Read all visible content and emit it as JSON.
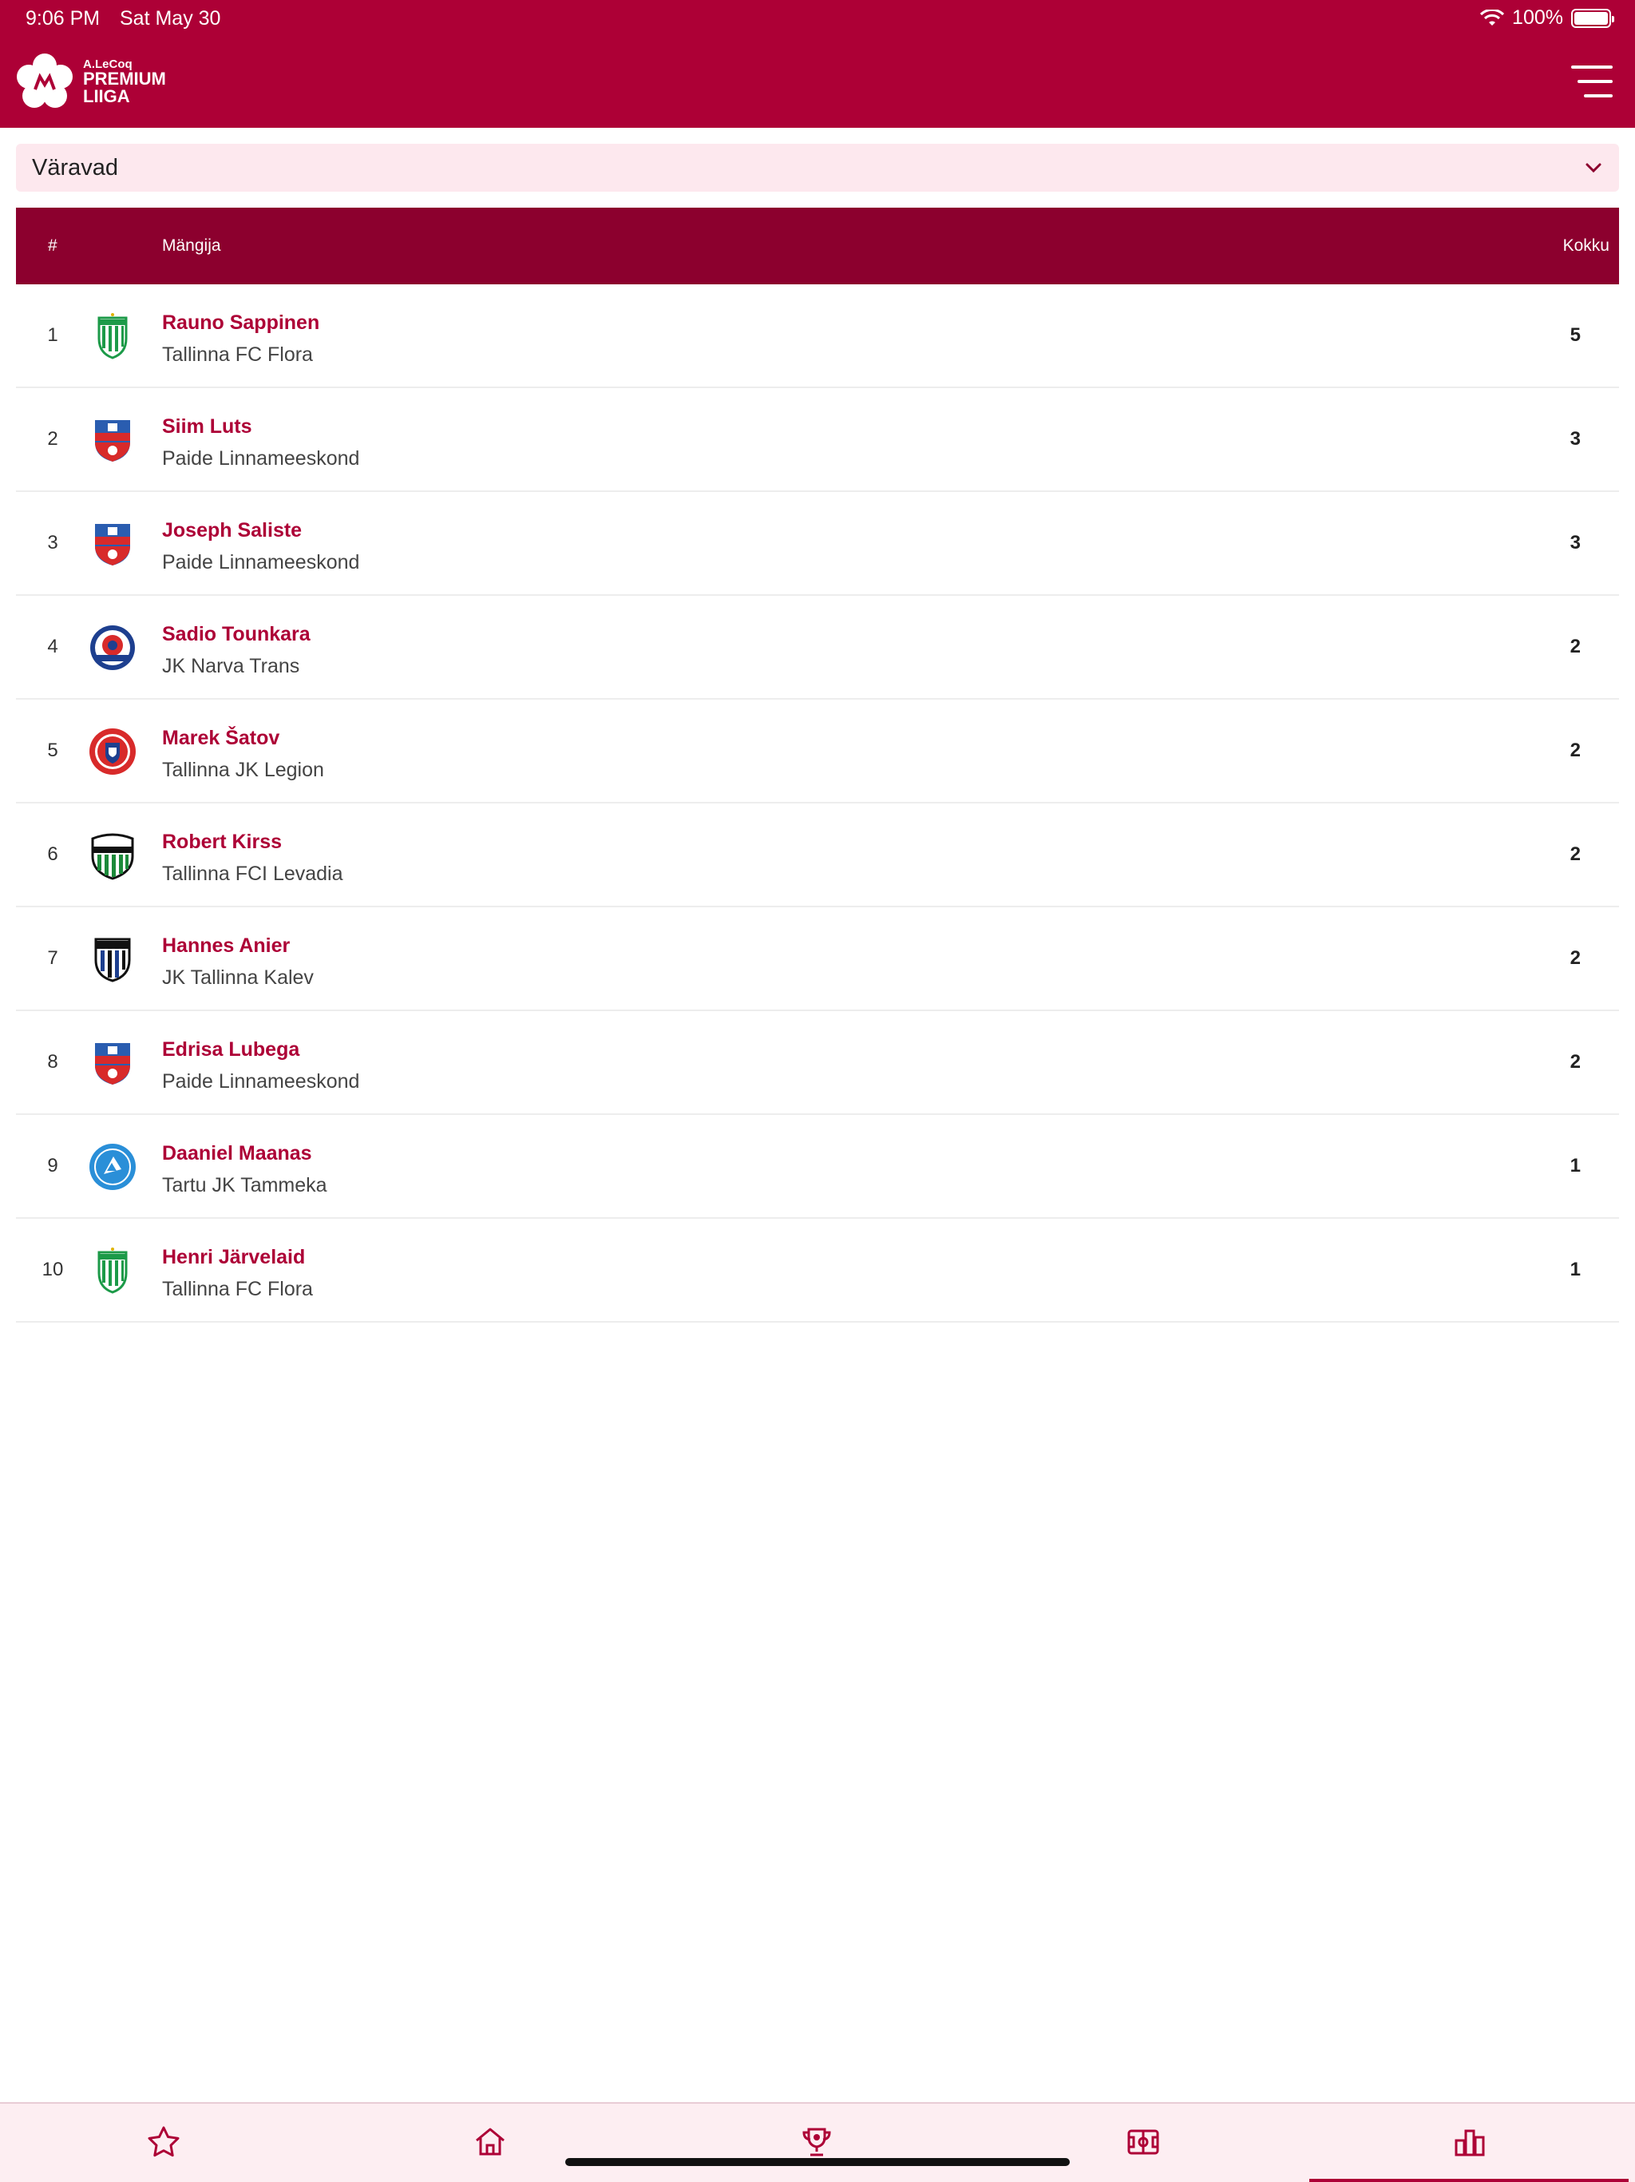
{
  "status_bar": {
    "time": "9:06 PM",
    "date": "Sat May 30",
    "battery": "100%"
  },
  "brand": {
    "line1": "A.LeCoq",
    "line2": "PREMIUM",
    "line3": "LIIGA"
  },
  "selector": {
    "label": "Väravad"
  },
  "table": {
    "headers": {
      "rank": "#",
      "player": "Mängija",
      "total": "Kokku"
    },
    "rows": [
      {
        "rank": "1",
        "name": "Rauno Sappinen",
        "team": "Tallinna FC Flora",
        "total": "5",
        "badge": "flora-badge-icon"
      },
      {
        "rank": "2",
        "name": "Siim Luts",
        "team": "Paide Linnameeskond",
        "total": "3",
        "badge": "paide-badge-icon"
      },
      {
        "rank": "3",
        "name": "Joseph Saliste",
        "team": "Paide Linnameeskond",
        "total": "3",
        "badge": "paide-badge-icon"
      },
      {
        "rank": "4",
        "name": "Sadio Tounkara",
        "team": "JK Narva Trans",
        "total": "2",
        "badge": "narva-badge-icon"
      },
      {
        "rank": "5",
        "name": "Marek Šatov",
        "team": "Tallinna JK Legion",
        "total": "2",
        "badge": "legion-badge-icon"
      },
      {
        "rank": "6",
        "name": "Robert Kirss",
        "team": "Tallinna FCI Levadia",
        "total": "2",
        "badge": "levadia-badge-icon"
      },
      {
        "rank": "7",
        "name": "Hannes Anier",
        "team": "JK Tallinna Kalev",
        "total": "2",
        "badge": "kalev-badge-icon"
      },
      {
        "rank": "8",
        "name": "Edrisa Lubega",
        "team": "Paide Linnameeskond",
        "total": "2",
        "badge": "paide-badge-icon"
      },
      {
        "rank": "9",
        "name": "Daaniel Maanas",
        "team": "Tartu JK Tammeka",
        "total": "1",
        "badge": "tammeka-badge-icon"
      },
      {
        "rank": "10",
        "name": "Henri Järvelaid",
        "team": "Tallinna FC Flora",
        "total": "1",
        "badge": "flora-badge-icon"
      }
    ]
  },
  "bottom_nav": [
    {
      "icon": "star-icon",
      "active": false
    },
    {
      "icon": "home-icon",
      "active": false
    },
    {
      "icon": "trophy-icon",
      "active": false
    },
    {
      "icon": "field-icon",
      "active": false
    },
    {
      "icon": "stats-icon",
      "active": true
    }
  ],
  "colors": {
    "brand": "#ad0036",
    "header_dark": "#8c002e",
    "selector_bg": "#fde8ee"
  }
}
